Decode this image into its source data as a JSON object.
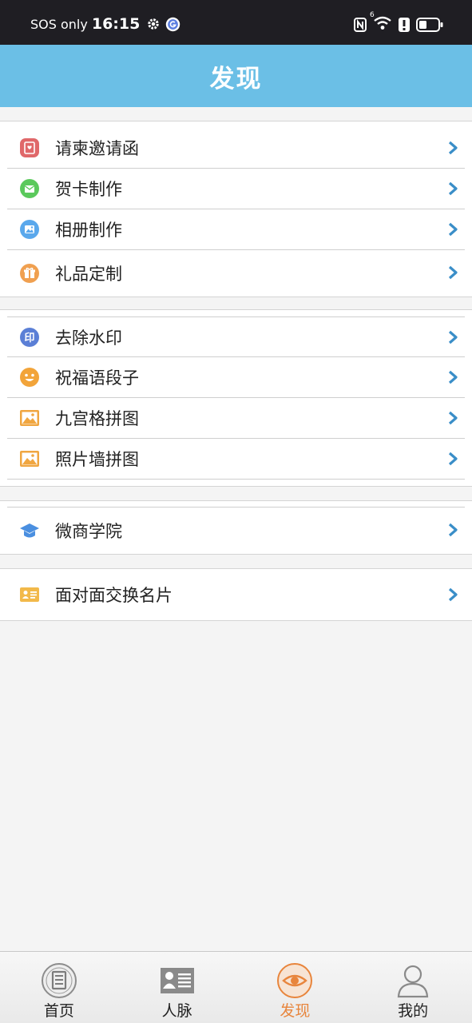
{
  "status_bar": {
    "carrier": "SOS only",
    "time": "16:15",
    "signal_badge": "6"
  },
  "header": {
    "title": "发现"
  },
  "groups": [
    {
      "items": [
        {
          "label": "请柬邀请函",
          "icon": "invitation-icon",
          "color": "#e0686a"
        },
        {
          "label": "贺卡制作",
          "icon": "mail-card-icon",
          "color": "#5bc95c"
        },
        {
          "label": "相册制作",
          "icon": "photo-album-icon",
          "color": "#5aa8ec"
        },
        {
          "label": "礼品定制",
          "icon": "gift-icon",
          "color": "#f0a050"
        }
      ]
    },
    {
      "items": [
        {
          "label": "去除水印",
          "icon": "watermark-stamp-icon",
          "color": "#5b7fd6"
        },
        {
          "label": "祝福语段子",
          "icon": "smiley-icon",
          "color": "#f2a43a"
        },
        {
          "label": "九宫格拼图",
          "icon": "grid-puzzle-image-icon",
          "color": "#f0a640"
        },
        {
          "label": "照片墙拼图",
          "icon": "photo-wall-image-icon",
          "color": "#f0a640"
        }
      ]
    },
    {
      "items": [
        {
          "label": "微商学院",
          "icon": "graduation-cap-icon",
          "color": "#4a8fe0"
        }
      ]
    },
    {
      "items": [
        {
          "label": "面对面交换名片",
          "icon": "business-card-icon",
          "color": "#f2b94a"
        }
      ]
    }
  ],
  "tabbar": {
    "tabs": [
      {
        "label": "首页",
        "icon": "home-document-icon",
        "active": false
      },
      {
        "label": "人脉",
        "icon": "contacts-card-icon",
        "active": false
      },
      {
        "label": "发现",
        "icon": "discover-eye-icon",
        "active": true
      },
      {
        "label": "我的",
        "icon": "profile-person-icon",
        "active": false
      }
    ],
    "active_color": "#e8853c"
  },
  "colors": {
    "header_bg": "#6bbfe6",
    "chevron": "#3a8ec8",
    "page_bg": "#f4f4f4"
  }
}
